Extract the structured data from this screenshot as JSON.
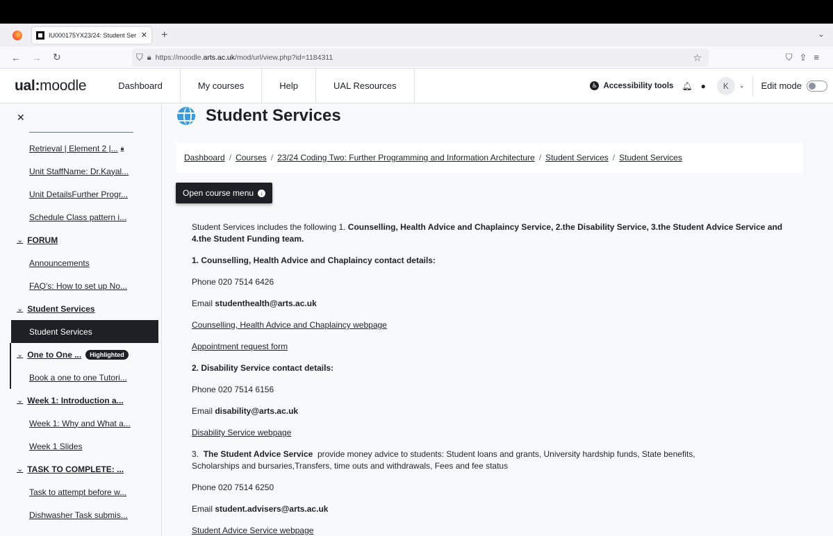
{
  "browser": {
    "tab_title": "IU000175YX23/24: Student Ser",
    "url_prefix": "https://moodle.",
    "url_domain": "arts.ac.uk",
    "url_path": "/mod/url/view.php?id=1184311"
  },
  "header": {
    "logo_bold": "ual:",
    "logo_rest": "moodle",
    "nav": [
      "Dashboard",
      "My courses",
      "Help",
      "UAL Resources"
    ],
    "accessibility": "Accessibility tools",
    "avatar_initial": "K",
    "edit_mode": "Edit mode"
  },
  "sidebar": {
    "items": [
      {
        "label": "Retrieval | Element 2 |..."
      },
      {
        "label": "Unit StaffName: Dr.Kayal..."
      },
      {
        "label": "Unit DetailsFurther Progr..."
      },
      {
        "label": "Schedule Class pattern i..."
      },
      {
        "label": "FORUM"
      },
      {
        "label": "Announcements"
      },
      {
        "label": "FAQ's: How to set up No..."
      },
      {
        "label": "Student Services"
      },
      {
        "label": "Student Services"
      },
      {
        "label": "One to One ..."
      },
      {
        "label": "Book a one to one Tutori..."
      },
      {
        "label": "Week 1: Introduction a..."
      },
      {
        "label": "Week 1: Why and What a..."
      },
      {
        "label": "Week 1 Slides"
      },
      {
        "label": "TASK TO COMPLETE: ..."
      },
      {
        "label": "Task to attempt before w..."
      },
      {
        "label": "Dishwasher Task submis..."
      }
    ],
    "highlight_badge": "Highlighted"
  },
  "page": {
    "title": "Student Services",
    "breadcrumb": [
      "Dashboard",
      "Courses",
      "23/24 Coding Two: Further Programming and Information Architecture",
      "Student Services",
      "Student Services"
    ],
    "course_menu_button": "Open course menu"
  },
  "content": {
    "intro_plain": "Student Services includes the following 1. ",
    "intro_bold": "Counselling, Health Advice and Chaplaincy Service, 2.the Disability Service, 3.the Student Advice Service and 4.the Student Funding team.",
    "s1_heading": "1. Counselling, Health Advice and Chaplaincy contact details:",
    "s1_phone": "Phone 020 7514 6426",
    "s1_email_label": "Email ",
    "s1_email": "studenthealth@arts.ac.uk",
    "s1_link1": "Counselling, Health Advice and Chaplaincy webpage",
    "s1_link2": "Appointment request form",
    "s2_heading": "2. Disability Service contact details:",
    "s2_phone": "Phone 020 7514 6156",
    "s2_email_label": "Email ",
    "s2_email": "disability@arts.ac.uk",
    "s2_link": "Disability Service webpage",
    "s3_prefix": "3.  ",
    "s3_bold": "The Student Advice Service",
    "s3_text": "  provide money advice to students: Student loans and grants, University hardship funds, State benefits, Scholarships and bursaries,Transfers, time outs and withdrawals, Fees and fee status",
    "s3_phone": "Phone 020 7514 6250",
    "s3_email_label": "Email ",
    "s3_email": "student.advisers@arts.ac.uk",
    "s3_link": "Student Advice Service webpage"
  }
}
